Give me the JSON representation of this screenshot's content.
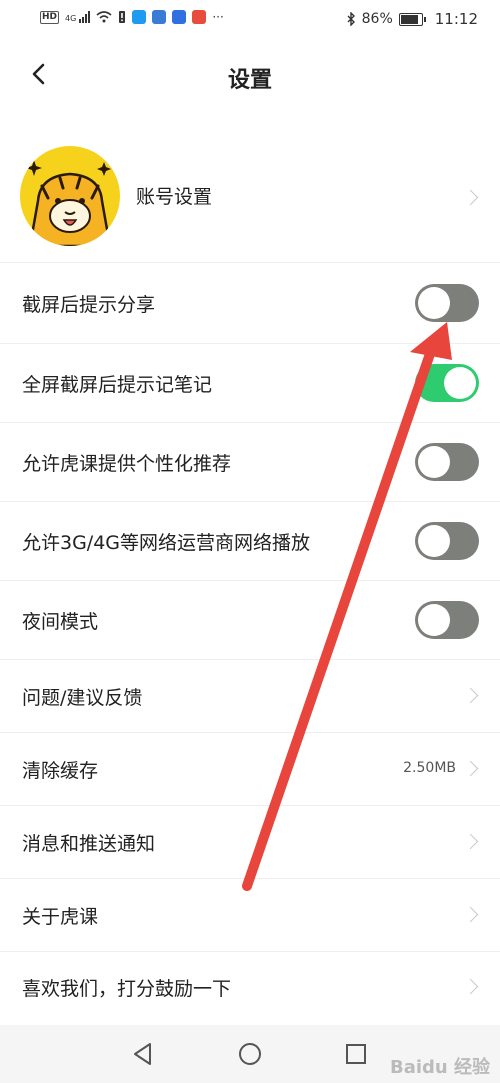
{
  "status_bar": {
    "hd": "HD",
    "network": "4G",
    "battery_pct": "86%",
    "time": "11:12",
    "battery_level": 0.86,
    "app_icon_colors": [
      "#1e9bf0",
      "#3a7bd5",
      "#2f6fe0",
      "#e84c3d"
    ]
  },
  "header": {
    "title": "设置"
  },
  "account": {
    "label": "账号设置"
  },
  "settings": [
    {
      "label": "截屏后提示分享",
      "type": "toggle",
      "on": false
    },
    {
      "label": "全屏截屏后提示记笔记",
      "type": "toggle",
      "on": true
    },
    {
      "label": "允许虎课提供个性化推荐",
      "type": "toggle",
      "on": false
    },
    {
      "label": "允许3G/4G等网络运营商网络播放",
      "type": "toggle",
      "on": false
    },
    {
      "label": "夜间模式",
      "type": "toggle",
      "on": false
    },
    {
      "label": "问题/建议反馈",
      "type": "link"
    },
    {
      "label": "清除缓存",
      "type": "link",
      "value": "2.50MB"
    },
    {
      "label": "消息和推送通知",
      "type": "link"
    },
    {
      "label": "关于虎课",
      "type": "link"
    },
    {
      "label": "喜欢我们，打分鼓励一下",
      "type": "link"
    }
  ],
  "colors": {
    "toggle_off": "#7d7f7a",
    "toggle_on": "#2ecb6f",
    "annotation_arrow": "#e8453c"
  },
  "watermark": "Baidu 经验"
}
